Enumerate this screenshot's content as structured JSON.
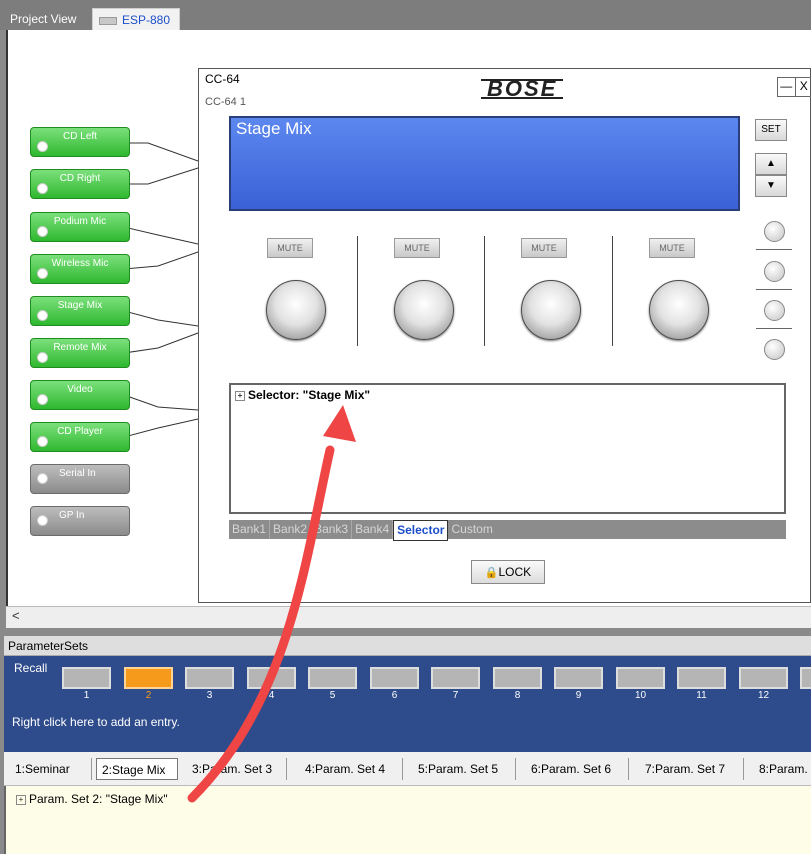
{
  "tabs": {
    "project_view": "Project View",
    "device": "ESP-880 1"
  },
  "signal_blocks": [
    {
      "label": "CD Left",
      "color": "green"
    },
    {
      "label": "CD Right",
      "color": "green"
    },
    {
      "label": "Podium Mic",
      "color": "green"
    },
    {
      "label": "Wireless Mic",
      "color": "green"
    },
    {
      "label": "Stage Mix",
      "color": "green"
    },
    {
      "label": "Remote Mix",
      "color": "green"
    },
    {
      "label": "Video",
      "color": "green"
    },
    {
      "label": "CD Player",
      "color": "green"
    },
    {
      "label": "Serial In",
      "color": "gray"
    },
    {
      "label": "GP In",
      "color": "gray"
    }
  ],
  "cc_panel": {
    "title": "CC-64",
    "subtitle": "CC-64 1",
    "brand": "BOSE",
    "minimize": "—",
    "close": "X",
    "display_text": "Stage Mix",
    "set_label": "SET",
    "up_label": "▲",
    "down_label": "▼",
    "mute_labels": [
      "MUTE",
      "MUTE",
      "MUTE",
      "MUTE"
    ],
    "tree_expand": "+",
    "tree_item": "Selector: \"Stage Mix\"",
    "bank_tabs": [
      "Bank1",
      "Bank2",
      "Bank3",
      "Bank4",
      "Selector",
      "Custom"
    ],
    "active_bank_tab": "Selector",
    "lock_icon": "🔒",
    "lock_label": "LOCK"
  },
  "scroll_left": "<",
  "parameter_sets": {
    "header": "ParameterSets",
    "recall_label": "Recall",
    "slots": [
      "1",
      "2",
      "3",
      "4",
      "5",
      "6",
      "7",
      "8",
      "9",
      "10",
      "11",
      "12"
    ],
    "selected_slot": "2",
    "hint": "Right click here to add an entry.",
    "tabs": [
      "1:Seminar",
      "2:Stage Mix",
      "3:Param. Set 3",
      "4:Param. Set 4",
      "5:Param. Set 5",
      "6:Param. Set 6",
      "7:Param. Set 7",
      "8:Param."
    ],
    "active_tab": "2:Stage Mix",
    "tree_expand": "+",
    "tree_item": "Param. Set 2: \"Stage Mix\""
  },
  "colors": {
    "lcd": "#4a74e4",
    "block_green": "#3cc23c",
    "selected_slot": "#f59a1a",
    "panel_blue": "#2e4c8b",
    "annotation_arrow": "#f04545"
  }
}
